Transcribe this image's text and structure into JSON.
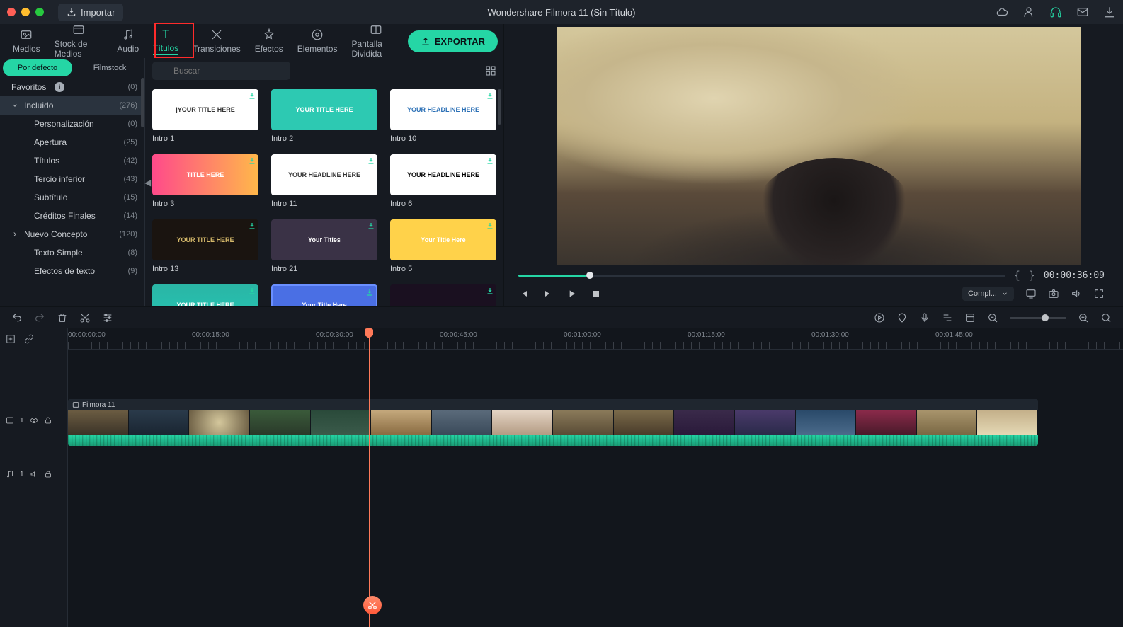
{
  "titlebar": {
    "import": "Importar",
    "title": "Wondershare Filmora 11 (Sin Título)"
  },
  "nav": {
    "medios": "Medios",
    "stock": "Stock de Medios",
    "audio": "Audio",
    "titulos": "Títulos",
    "transiciones": "Transiciones",
    "efectos": "Efectos",
    "elementos": "Elementos",
    "pantalla": "Pantalla Dividida",
    "export": "EXPORTAR"
  },
  "tree_tabs": {
    "default": "Por defecto",
    "filmstock": "Filmstock"
  },
  "tree": [
    {
      "label": "Favoritos",
      "count": "(0)",
      "info": true
    },
    {
      "label": "Incluido",
      "count": "(276)",
      "chev": "down",
      "sel": true
    },
    {
      "label": "Personalización",
      "count": "(0)",
      "sub": true
    },
    {
      "label": "Apertura",
      "count": "(25)",
      "sub": true
    },
    {
      "label": "Títulos",
      "count": "(42)",
      "sub": true
    },
    {
      "label": "Tercio inferior",
      "count": "(43)",
      "sub": true
    },
    {
      "label": "Subtítulo",
      "count": "(15)",
      "sub": true
    },
    {
      "label": "Créditos Finales",
      "count": "(14)",
      "sub": true
    },
    {
      "label": "Nuevo Concepto",
      "count": "(120)",
      "chev": "right"
    },
    {
      "label": "Texto Simple",
      "count": "(8)",
      "sub": true
    },
    {
      "label": "Efectos de texto",
      "count": "(9)",
      "sub": true
    }
  ],
  "search": {
    "placeholder": "Buscar"
  },
  "thumbs": [
    {
      "label": "Intro 1",
      "cls": "t1",
      "txt": "|YOUR TITLE HERE"
    },
    {
      "label": "Intro 2",
      "cls": "t2",
      "txt": "YOUR TITLE HERE"
    },
    {
      "label": "Intro 10",
      "cls": "t3",
      "txt": "YOUR HEADLINE HERE"
    },
    {
      "label": "Intro 3",
      "cls": "t4",
      "txt": "TITLE HERE"
    },
    {
      "label": "Intro 11",
      "cls": "t5",
      "txt": "YOUR HEADLINE HERE"
    },
    {
      "label": "Intro 6",
      "cls": "t6",
      "txt": "YOUR HEADLINE HERE"
    },
    {
      "label": "Intro 13",
      "cls": "t7",
      "txt": "YOUR TITLE HERE"
    },
    {
      "label": "Intro 21",
      "cls": "t8",
      "txt": "Your Titles"
    },
    {
      "label": "Intro 5",
      "cls": "t9",
      "txt": "Your Title Here"
    },
    {
      "label": "",
      "cls": "t10",
      "txt": "YOUR TITLE HERE"
    },
    {
      "label": "",
      "cls": "t11",
      "txt": "Your Title Here"
    },
    {
      "label": "",
      "cls": "t12",
      "txt": ""
    }
  ],
  "preview": {
    "timecode": "00:00:36:09",
    "quality": "Compl..."
  },
  "ruler": [
    "00:00:00:00",
    "00:00:15:00",
    "00:00:30:00",
    "00:00:45:00",
    "00:01:00:00",
    "00:01:15:00",
    "00:01:30:00",
    "00:01:45:00"
  ],
  "clip": {
    "name": "Filmora 11"
  },
  "tracks": {
    "video": "1",
    "audio": "1"
  }
}
